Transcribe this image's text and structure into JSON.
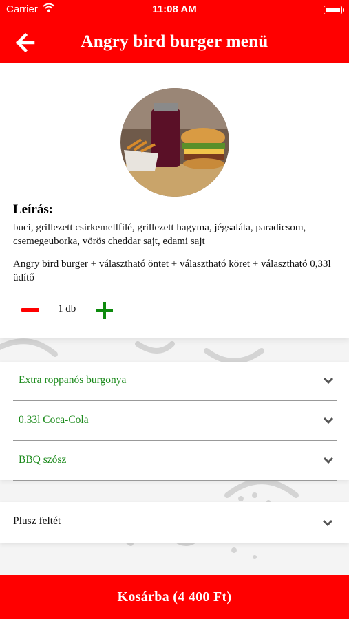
{
  "status_bar": {
    "carrier": "Carrier",
    "time": "11:08 AM"
  },
  "header": {
    "title": "Angry bird burger menü",
    "back_icon": "arrow-left-icon"
  },
  "product": {
    "description_title": "Leírás:",
    "description": "buci, grillezett csirkemellfilé, grillezett hagyma, jégsaláta, paradicsom, csemegeuborka, vörös cheddar sajt, edami sajt",
    "menu_contents": "Angry bird burger + választható öntet + választható köret + választható 0,33l üdítő",
    "quantity": "1 db"
  },
  "options": [
    {
      "label": "Extra roppanós burgonya"
    },
    {
      "label": "0.33l Coca-Cola"
    },
    {
      "label": "BBQ szósz"
    }
  ],
  "extra": {
    "label": "Plusz feltét"
  },
  "cart_button": {
    "label": "Kosárba (4 400 Ft)"
  },
  "colors": {
    "brand_red": "#ff0000",
    "option_green": "#1b8a1b",
    "plus_green": "#0d8a0d"
  }
}
